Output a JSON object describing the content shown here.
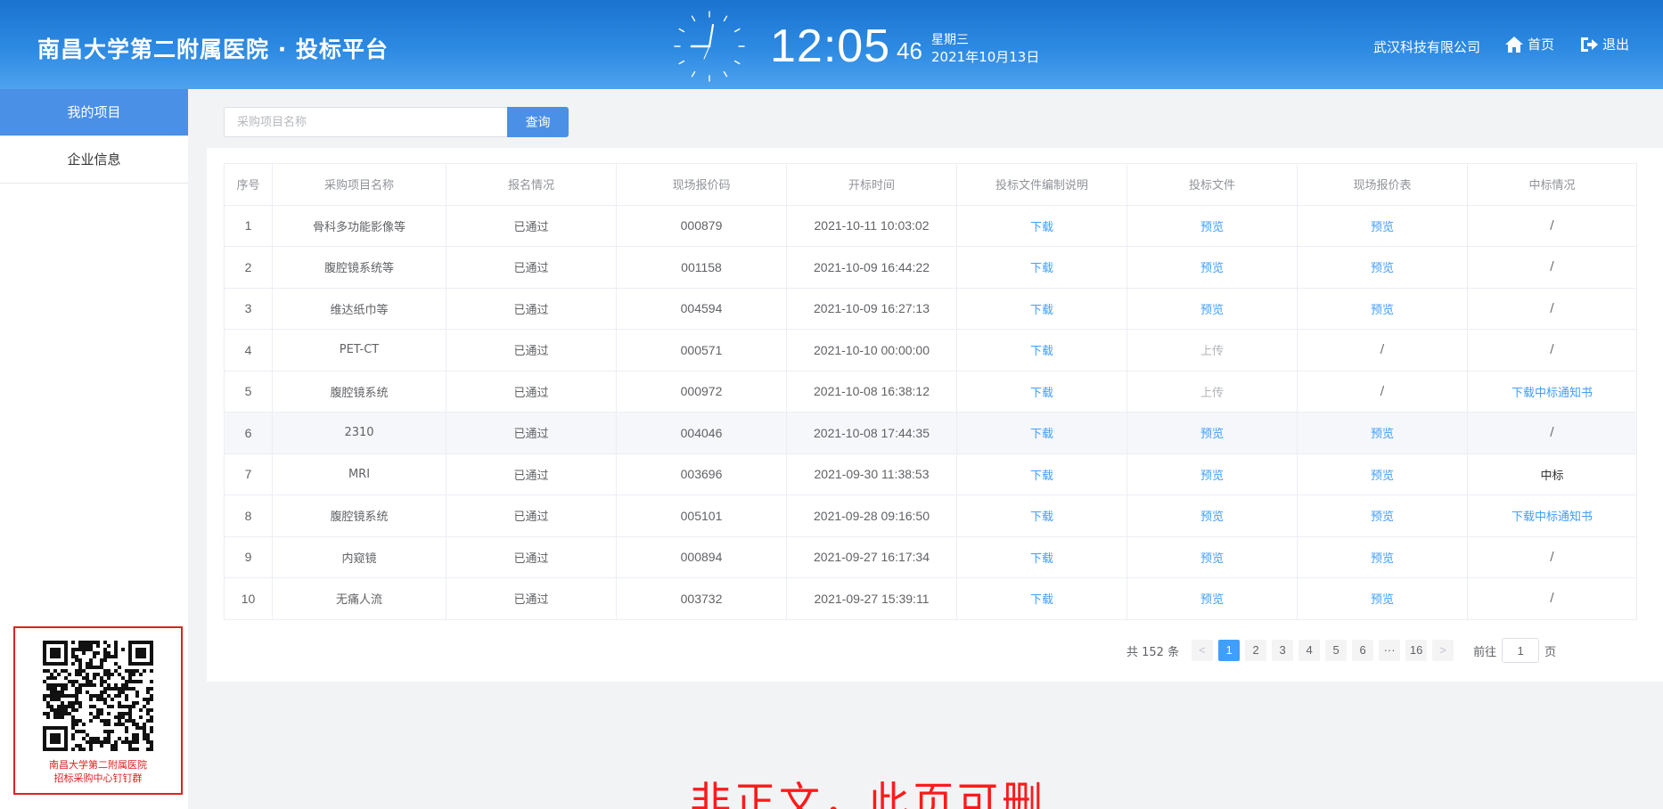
{
  "header": {
    "brand": "南昌大学第二附属医院 · 投标平台",
    "time_main": "12:05",
    "time_seconds": "46",
    "weekday": "星期三",
    "date": "2021年10月13日",
    "company": "武汉科技有限公司",
    "home_label": "首页",
    "exit_label": "退出"
  },
  "sidebar": {
    "items": [
      {
        "label": "我的项目",
        "active": true
      },
      {
        "label": "企业信息",
        "active": false
      }
    ],
    "qr_caption_line1": "南昌大学第二附属医院",
    "qr_caption_line2": "招标采购中心钉钉群"
  },
  "search": {
    "placeholder": "采购项目名称",
    "button": "查询"
  },
  "table": {
    "headers": [
      "序号",
      "采购项目名称",
      "报名情况",
      "现场报价码",
      "开标时间",
      "投标文件编制说明",
      "投标文件",
      "现场报价表",
      "中标情况"
    ],
    "rows": [
      {
        "no": "1",
        "name": "骨科多功能影像等",
        "status": "已通过",
        "code": "000879",
        "time": "2021-10-11 10:03:02",
        "guide": "下载",
        "file": "预览",
        "quote": "预览",
        "result": "/"
      },
      {
        "no": "2",
        "name": "腹腔镜系统等",
        "status": "已通过",
        "code": "001158",
        "time": "2021-10-09 16:44:22",
        "guide": "下载",
        "file": "预览",
        "quote": "预览",
        "result": "/"
      },
      {
        "no": "3",
        "name": "维达纸巾等",
        "status": "已通过",
        "code": "004594",
        "time": "2021-10-09 16:27:13",
        "guide": "下载",
        "file": "预览",
        "quote": "预览",
        "result": "/"
      },
      {
        "no": "4",
        "name": "PET-CT",
        "status": "已通过",
        "code": "000571",
        "time": "2021-10-10 00:00:00",
        "guide": "下载",
        "file": "上传",
        "quote": "/",
        "result": "/"
      },
      {
        "no": "5",
        "name": "腹腔镜系统",
        "status": "已通过",
        "code": "000972",
        "time": "2021-10-08 16:38:12",
        "guide": "下载",
        "file": "上传",
        "quote": "/",
        "result": "下载中标通知书"
      },
      {
        "no": "6",
        "name": "2310",
        "status": "已通过",
        "code": "004046",
        "time": "2021-10-08 17:44:35",
        "guide": "下载",
        "file": "预览",
        "quote": "预览",
        "result": "/"
      },
      {
        "no": "7",
        "name": "MRI",
        "status": "已通过",
        "code": "003696",
        "time": "2021-09-30 11:38:53",
        "guide": "下载",
        "file": "预览",
        "quote": "预览",
        "result": "中标"
      },
      {
        "no": "8",
        "name": "腹腔镜系统",
        "status": "已通过",
        "code": "005101",
        "time": "2021-09-28 09:16:50",
        "guide": "下载",
        "file": "预览",
        "quote": "预览",
        "result": "下载中标通知书"
      },
      {
        "no": "9",
        "name": "内窥镜",
        "status": "已通过",
        "code": "000894",
        "time": "2021-09-27 16:17:34",
        "guide": "下载",
        "file": "预览",
        "quote": "预览",
        "result": "/"
      },
      {
        "no": "10",
        "name": "无痛人流",
        "status": "已通过",
        "code": "003732",
        "time": "2021-09-27 15:39:11",
        "guide": "下载",
        "file": "预览",
        "quote": "预览",
        "result": "/"
      }
    ]
  },
  "pagination": {
    "total": "共 152 条",
    "prev": "<",
    "next": ">",
    "pages": [
      "1",
      "2",
      "3",
      "4",
      "5",
      "6",
      "···",
      "16"
    ],
    "current_page": "1",
    "goto_label": "前往",
    "goto_value": "1",
    "page_unit": "页"
  },
  "watermark": "非正文，此页可删",
  "colors": {
    "header_blue": "#2d8ae2",
    "accent": "#409eff",
    "sidebar_active": "#4a90e7",
    "qr_border": "#e02020",
    "watermark": "#ff1a1a"
  }
}
